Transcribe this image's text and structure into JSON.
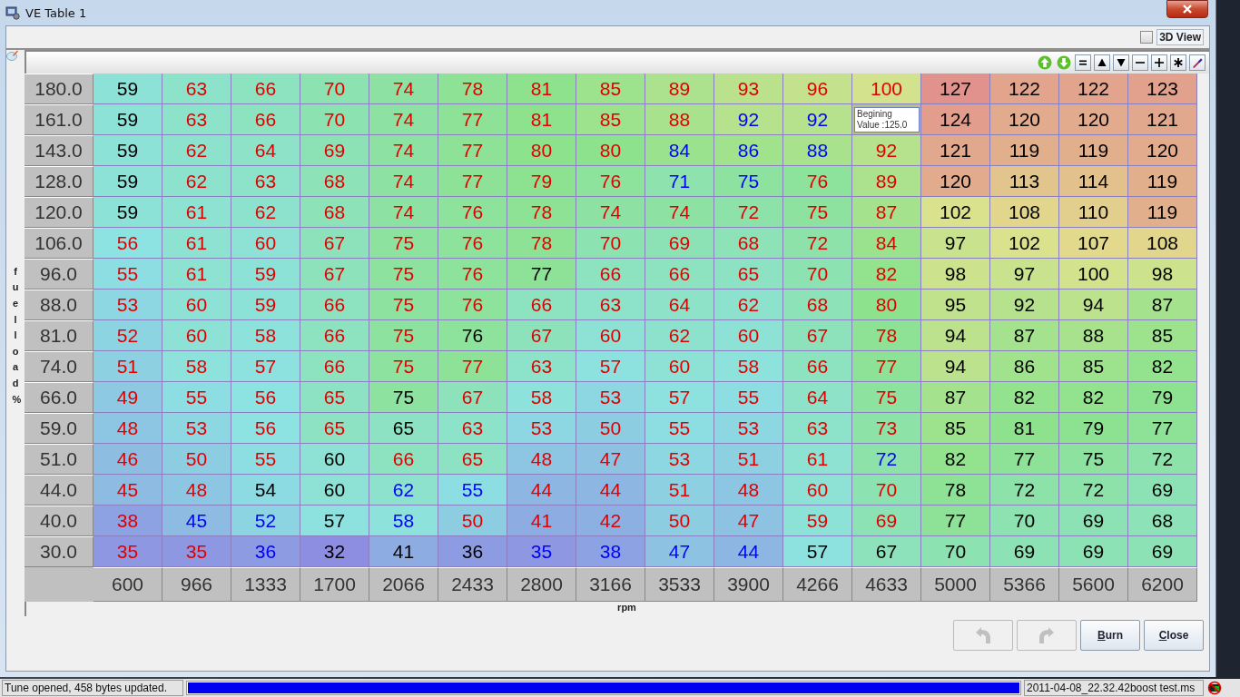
{
  "window": {
    "title": "VE Table 1"
  },
  "view_3d": {
    "label": "3D View",
    "checked": false
  },
  "table": {
    "y_axis_label": "fuel load %",
    "x_axis_label": "rpm",
    "x_axis": [
      "600",
      "966",
      "1333",
      "1700",
      "2066",
      "2433",
      "2800",
      "3166",
      "3533",
      "3900",
      "4266",
      "4633",
      "5000",
      "5366",
      "5600",
      "6200"
    ],
    "rows": [
      {
        "label": "180.0",
        "cells": [
          {
            "value": "59",
            "kind": "same"
          },
          {
            "value": "63",
            "kind": "up"
          },
          {
            "value": "66",
            "kind": "up"
          },
          {
            "value": "70",
            "kind": "up"
          },
          {
            "value": "74",
            "kind": "up"
          },
          {
            "value": "78",
            "kind": "up"
          },
          {
            "value": "81",
            "kind": "up"
          },
          {
            "value": "85",
            "kind": "up"
          },
          {
            "value": "89",
            "kind": "up"
          },
          {
            "value": "93",
            "kind": "up"
          },
          {
            "value": "96",
            "kind": "up"
          },
          {
            "value": "100",
            "kind": "up"
          },
          {
            "value": "127",
            "kind": "same"
          },
          {
            "value": "122",
            "kind": "same"
          },
          {
            "value": "122",
            "kind": "same"
          },
          {
            "value": "123",
            "kind": "same"
          }
        ]
      },
      {
        "label": "161.0",
        "cells": [
          {
            "value": "59",
            "kind": "same"
          },
          {
            "value": "63",
            "kind": "up"
          },
          {
            "value": "66",
            "kind": "up"
          },
          {
            "value": "70",
            "kind": "up"
          },
          {
            "value": "74",
            "kind": "up"
          },
          {
            "value": "77",
            "kind": "up"
          },
          {
            "value": "81",
            "kind": "up"
          },
          {
            "value": "85",
            "kind": "up"
          },
          {
            "value": "88",
            "kind": "up"
          },
          {
            "value": "92",
            "kind": "down"
          },
          {
            "value": "92",
            "kind": "down"
          },
          {
            "tooltip": "Begining Value :125.0"
          },
          {
            "value": "124",
            "kind": "same"
          },
          {
            "value": "120",
            "kind": "same"
          },
          {
            "value": "120",
            "kind": "same"
          },
          {
            "value": "121",
            "kind": "same"
          }
        ]
      },
      {
        "label": "143.0",
        "cells": [
          {
            "value": "59",
            "kind": "same"
          },
          {
            "value": "62",
            "kind": "up"
          },
          {
            "value": "64",
            "kind": "up"
          },
          {
            "value": "69",
            "kind": "up"
          },
          {
            "value": "74",
            "kind": "up"
          },
          {
            "value": "77",
            "kind": "up"
          },
          {
            "value": "80",
            "kind": "up"
          },
          {
            "value": "80",
            "kind": "up"
          },
          {
            "value": "84",
            "kind": "down"
          },
          {
            "value": "86",
            "kind": "down"
          },
          {
            "value": "88",
            "kind": "down"
          },
          {
            "value": "92",
            "kind": "up"
          },
          {
            "value": "121",
            "kind": "same"
          },
          {
            "value": "119",
            "kind": "same"
          },
          {
            "value": "119",
            "kind": "same"
          },
          {
            "value": "120",
            "kind": "same"
          }
        ]
      },
      {
        "label": "128.0",
        "cells": [
          {
            "value": "59",
            "kind": "same"
          },
          {
            "value": "62",
            "kind": "up"
          },
          {
            "value": "63",
            "kind": "up"
          },
          {
            "value": "68",
            "kind": "up"
          },
          {
            "value": "74",
            "kind": "up"
          },
          {
            "value": "77",
            "kind": "up"
          },
          {
            "value": "79",
            "kind": "up"
          },
          {
            "value": "76",
            "kind": "up"
          },
          {
            "value": "71",
            "kind": "down"
          },
          {
            "value": "75",
            "kind": "down"
          },
          {
            "value": "76",
            "kind": "up"
          },
          {
            "value": "89",
            "kind": "up"
          },
          {
            "value": "120",
            "kind": "same"
          },
          {
            "value": "113",
            "kind": "same"
          },
          {
            "value": "114",
            "kind": "same"
          },
          {
            "value": "119",
            "kind": "same"
          }
        ]
      },
      {
        "label": "120.0",
        "cells": [
          {
            "value": "59",
            "kind": "same"
          },
          {
            "value": "61",
            "kind": "up"
          },
          {
            "value": "62",
            "kind": "up"
          },
          {
            "value": "68",
            "kind": "up"
          },
          {
            "value": "74",
            "kind": "up"
          },
          {
            "value": "76",
            "kind": "up"
          },
          {
            "value": "78",
            "kind": "up"
          },
          {
            "value": "74",
            "kind": "up"
          },
          {
            "value": "74",
            "kind": "up"
          },
          {
            "value": "72",
            "kind": "up"
          },
          {
            "value": "75",
            "kind": "up"
          },
          {
            "value": "87",
            "kind": "up"
          },
          {
            "value": "102",
            "kind": "same"
          },
          {
            "value": "108",
            "kind": "same"
          },
          {
            "value": "110",
            "kind": "same"
          },
          {
            "value": "119",
            "kind": "same"
          }
        ]
      },
      {
        "label": "106.0",
        "cells": [
          {
            "value": "56",
            "kind": "up"
          },
          {
            "value": "61",
            "kind": "up"
          },
          {
            "value": "60",
            "kind": "up"
          },
          {
            "value": "67",
            "kind": "up"
          },
          {
            "value": "75",
            "kind": "up"
          },
          {
            "value": "76",
            "kind": "up"
          },
          {
            "value": "78",
            "kind": "up"
          },
          {
            "value": "70",
            "kind": "up"
          },
          {
            "value": "69",
            "kind": "up"
          },
          {
            "value": "68",
            "kind": "up"
          },
          {
            "value": "72",
            "kind": "up"
          },
          {
            "value": "84",
            "kind": "up"
          },
          {
            "value": "97",
            "kind": "same"
          },
          {
            "value": "102",
            "kind": "same"
          },
          {
            "value": "107",
            "kind": "same"
          },
          {
            "value": "108",
            "kind": "same"
          }
        ]
      },
      {
        "label": "96.0",
        "cells": [
          {
            "value": "55",
            "kind": "up"
          },
          {
            "value": "61",
            "kind": "up"
          },
          {
            "value": "59",
            "kind": "up"
          },
          {
            "value": "67",
            "kind": "up"
          },
          {
            "value": "75",
            "kind": "up"
          },
          {
            "value": "76",
            "kind": "up"
          },
          {
            "value": "77",
            "kind": "same"
          },
          {
            "value": "66",
            "kind": "up"
          },
          {
            "value": "66",
            "kind": "up"
          },
          {
            "value": "65",
            "kind": "up"
          },
          {
            "value": "70",
            "kind": "up"
          },
          {
            "value": "82",
            "kind": "up"
          },
          {
            "value": "98",
            "kind": "same"
          },
          {
            "value": "97",
            "kind": "same"
          },
          {
            "value": "100",
            "kind": "same"
          },
          {
            "value": "98",
            "kind": "same"
          }
        ]
      },
      {
        "label": "88.0",
        "cells": [
          {
            "value": "53",
            "kind": "up"
          },
          {
            "value": "60",
            "kind": "up"
          },
          {
            "value": "59",
            "kind": "up"
          },
          {
            "value": "66",
            "kind": "up"
          },
          {
            "value": "75",
            "kind": "up"
          },
          {
            "value": "76",
            "kind": "up"
          },
          {
            "value": "66",
            "kind": "up"
          },
          {
            "value": "63",
            "kind": "up"
          },
          {
            "value": "64",
            "kind": "up"
          },
          {
            "value": "62",
            "kind": "up"
          },
          {
            "value": "68",
            "kind": "up"
          },
          {
            "value": "80",
            "kind": "up"
          },
          {
            "value": "95",
            "kind": "same"
          },
          {
            "value": "92",
            "kind": "same"
          },
          {
            "value": "94",
            "kind": "same"
          },
          {
            "value": "87",
            "kind": "same"
          }
        ]
      },
      {
        "label": "81.0",
        "cells": [
          {
            "value": "52",
            "kind": "up"
          },
          {
            "value": "60",
            "kind": "up"
          },
          {
            "value": "58",
            "kind": "up"
          },
          {
            "value": "66",
            "kind": "up"
          },
          {
            "value": "75",
            "kind": "up"
          },
          {
            "value": "76",
            "kind": "same"
          },
          {
            "value": "67",
            "kind": "up"
          },
          {
            "value": "60",
            "kind": "up"
          },
          {
            "value": "62",
            "kind": "up"
          },
          {
            "value": "60",
            "kind": "up"
          },
          {
            "value": "67",
            "kind": "up"
          },
          {
            "value": "78",
            "kind": "up"
          },
          {
            "value": "94",
            "kind": "same"
          },
          {
            "value": "87",
            "kind": "same"
          },
          {
            "value": "88",
            "kind": "same"
          },
          {
            "value": "85",
            "kind": "same"
          }
        ]
      },
      {
        "label": "74.0",
        "cells": [
          {
            "value": "51",
            "kind": "up"
          },
          {
            "value": "58",
            "kind": "up"
          },
          {
            "value": "57",
            "kind": "up"
          },
          {
            "value": "66",
            "kind": "up"
          },
          {
            "value": "75",
            "kind": "up"
          },
          {
            "value": "77",
            "kind": "up"
          },
          {
            "value": "63",
            "kind": "up"
          },
          {
            "value": "57",
            "kind": "up"
          },
          {
            "value": "60",
            "kind": "up"
          },
          {
            "value": "58",
            "kind": "up"
          },
          {
            "value": "66",
            "kind": "up"
          },
          {
            "value": "77",
            "kind": "up"
          },
          {
            "value": "94",
            "kind": "same"
          },
          {
            "value": "86",
            "kind": "same"
          },
          {
            "value": "85",
            "kind": "same"
          },
          {
            "value": "82",
            "kind": "same"
          }
        ]
      },
      {
        "label": "66.0",
        "cells": [
          {
            "value": "49",
            "kind": "up"
          },
          {
            "value": "55",
            "kind": "up"
          },
          {
            "value": "56",
            "kind": "up"
          },
          {
            "value": "65",
            "kind": "up"
          },
          {
            "value": "75",
            "kind": "same"
          },
          {
            "value": "67",
            "kind": "up"
          },
          {
            "value": "58",
            "kind": "up"
          },
          {
            "value": "53",
            "kind": "up"
          },
          {
            "value": "57",
            "kind": "up"
          },
          {
            "value": "55",
            "kind": "up"
          },
          {
            "value": "64",
            "kind": "up"
          },
          {
            "value": "75",
            "kind": "up"
          },
          {
            "value": "87",
            "kind": "same"
          },
          {
            "value": "82",
            "kind": "same"
          },
          {
            "value": "82",
            "kind": "same"
          },
          {
            "value": "79",
            "kind": "same"
          }
        ]
      },
      {
        "label": "59.0",
        "cells": [
          {
            "value": "48",
            "kind": "up"
          },
          {
            "value": "53",
            "kind": "up"
          },
          {
            "value": "56",
            "kind": "up"
          },
          {
            "value": "65",
            "kind": "up"
          },
          {
            "value": "65",
            "kind": "same"
          },
          {
            "value": "63",
            "kind": "up"
          },
          {
            "value": "53",
            "kind": "up"
          },
          {
            "value": "50",
            "kind": "up"
          },
          {
            "value": "55",
            "kind": "up"
          },
          {
            "value": "53",
            "kind": "up"
          },
          {
            "value": "63",
            "kind": "up"
          },
          {
            "value": "73",
            "kind": "up"
          },
          {
            "value": "85",
            "kind": "same"
          },
          {
            "value": "81",
            "kind": "same"
          },
          {
            "value": "79",
            "kind": "same"
          },
          {
            "value": "77",
            "kind": "same"
          }
        ]
      },
      {
        "label": "51.0",
        "cells": [
          {
            "value": "46",
            "kind": "up"
          },
          {
            "value": "50",
            "kind": "up"
          },
          {
            "value": "55",
            "kind": "up"
          },
          {
            "value": "60",
            "kind": "same"
          },
          {
            "value": "66",
            "kind": "up"
          },
          {
            "value": "65",
            "kind": "up"
          },
          {
            "value": "48",
            "kind": "up"
          },
          {
            "value": "47",
            "kind": "up"
          },
          {
            "value": "53",
            "kind": "up"
          },
          {
            "value": "51",
            "kind": "up"
          },
          {
            "value": "61",
            "kind": "up"
          },
          {
            "value": "72",
            "kind": "down"
          },
          {
            "value": "82",
            "kind": "same"
          },
          {
            "value": "77",
            "kind": "same"
          },
          {
            "value": "75",
            "kind": "same"
          },
          {
            "value": "72",
            "kind": "same"
          }
        ]
      },
      {
        "label": "44.0",
        "cells": [
          {
            "value": "45",
            "kind": "up"
          },
          {
            "value": "48",
            "kind": "up"
          },
          {
            "value": "54",
            "kind": "same"
          },
          {
            "value": "60",
            "kind": "same"
          },
          {
            "value": "62",
            "kind": "down"
          },
          {
            "value": "55",
            "kind": "down"
          },
          {
            "value": "44",
            "kind": "up"
          },
          {
            "value": "44",
            "kind": "up"
          },
          {
            "value": "51",
            "kind": "up"
          },
          {
            "value": "48",
            "kind": "up"
          },
          {
            "value": "60",
            "kind": "up"
          },
          {
            "value": "70",
            "kind": "up"
          },
          {
            "value": "78",
            "kind": "same"
          },
          {
            "value": "72",
            "kind": "same"
          },
          {
            "value": "72",
            "kind": "same"
          },
          {
            "value": "69",
            "kind": "same"
          }
        ]
      },
      {
        "label": "40.0",
        "cells": [
          {
            "value": "38",
            "kind": "up"
          },
          {
            "value": "45",
            "kind": "down"
          },
          {
            "value": "52",
            "kind": "down"
          },
          {
            "value": "57",
            "kind": "same"
          },
          {
            "value": "58",
            "kind": "down"
          },
          {
            "value": "50",
            "kind": "up"
          },
          {
            "value": "41",
            "kind": "up"
          },
          {
            "value": "42",
            "kind": "up"
          },
          {
            "value": "50",
            "kind": "up"
          },
          {
            "value": "47",
            "kind": "up"
          },
          {
            "value": "59",
            "kind": "up"
          },
          {
            "value": "69",
            "kind": "up"
          },
          {
            "value": "77",
            "kind": "same"
          },
          {
            "value": "70",
            "kind": "same"
          },
          {
            "value": "69",
            "kind": "same"
          },
          {
            "value": "68",
            "kind": "same"
          }
        ]
      },
      {
        "label": "30.0",
        "cells": [
          {
            "value": "35",
            "kind": "up"
          },
          {
            "value": "35",
            "kind": "up"
          },
          {
            "value": "36",
            "kind": "down"
          },
          {
            "value": "32",
            "kind": "same"
          },
          {
            "value": "41",
            "kind": "same"
          },
          {
            "value": "36",
            "kind": "same"
          },
          {
            "value": "35",
            "kind": "down"
          },
          {
            "value": "38",
            "kind": "down"
          },
          {
            "value": "47",
            "kind": "down"
          },
          {
            "value": "44",
            "kind": "down"
          },
          {
            "value": "57",
            "kind": "same"
          },
          {
            "value": "67",
            "kind": "same"
          },
          {
            "value": "70",
            "kind": "same"
          },
          {
            "value": "69",
            "kind": "same"
          },
          {
            "value": "69",
            "kind": "same"
          },
          {
            "value": "69",
            "kind": "same"
          }
        ]
      }
    ]
  },
  "buttons": [
    {
      "kind": "undo",
      "disabled": true
    },
    {
      "kind": "redo",
      "disabled": true
    },
    {
      "kind": "text",
      "label": "Burn",
      "disabled": false
    },
    {
      "kind": "text",
      "label": "Close",
      "disabled": false
    }
  ],
  "status_bar": {
    "message": "Tune opened, 458 bytes updated.",
    "progress": {
      "level": 1
    },
    "file": "2011-04-08_22.32.42boost test.ms"
  }
}
